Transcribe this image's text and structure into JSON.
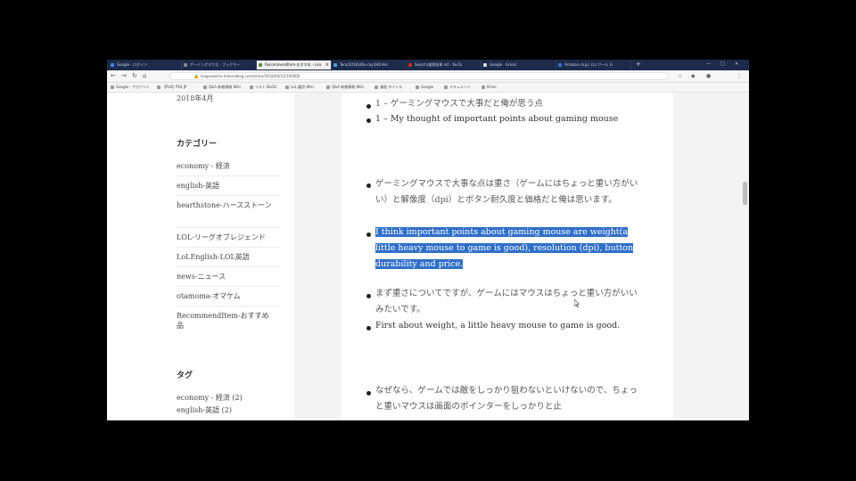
{
  "browser": {
    "tabs": [
      {
        "label": "Google - ログイン",
        "color": "#4285f4",
        "active": false
      },
      {
        "label": "ゲーミングマウス - ブックマー",
        "color": "#888888",
        "active": false
      },
      {
        "label": "RecommendItem-おすすめ – Lea",
        "color": "#5a8f3c",
        "active": true
      },
      {
        "label": "Tera(2018)(Blu-ray)/HD-Ver",
        "color": "#4aa0e0",
        "active": false
      },
      {
        "label": "Search(検索結果 ref - YouTu",
        "color": "#e02020",
        "active": false
      },
      {
        "label": "Google - Gmail",
        "color": "#e0e0e0",
        "active": false
      },
      {
        "label": "Amazon.co.jp: ロジクール G",
        "color": "#3a6fd8",
        "active": false
      }
    ],
    "new_tab_label": "+",
    "window_controls": [
      "—",
      "□",
      "✕"
    ],
    "url": "leaguelolmo.hatenablog.com/entry/2018/04/13/193000",
    "bookmarks": [
      "Google - アカウント",
      "【Ps4】PS4 JP",
      "Q&A 新着情報 Wiki",
      "リスト BLOG",
      "LoL 翻訳 Wiki",
      "Q&A 新着情報 Wiki",
      "漫画 タイトル",
      "Google",
      "ドキュメント",
      "Drive"
    ]
  },
  "sidebar": {
    "archive_date": "2018年4月",
    "categories_heading": "カテゴリー",
    "categories": [
      "economy - 経済",
      "english-英語",
      "hearthstone-ハースストーン",
      "LOL-リーグオブレジェンド",
      "LoLEnglish-LOL英語",
      "news-ニュース",
      "otamoma-オマケム",
      "RecommendItem-おすすめ品"
    ],
    "tags_heading": "タグ",
    "tags": [
      "economy - 経済 (2)",
      "english-英語 (2)"
    ]
  },
  "article": {
    "heading_ja": "1 – ゲーミングマウスで大事だと俺が思う点",
    "heading_en": "1 – My thought of important points about gaming mouse",
    "p1_ja": "ゲーミングマウスで大事な点は重さ（ゲームにはちょっと重い方がいい）と解像度（dpi）とボタン耐久度と価格だと俺は思います。",
    "p1_en": "I think important points about gaming mouse are weight(a little heavy mouse to game is good), resolution (dpi), button durability and price.",
    "p2_ja": "まず重さについてですが、ゲームにはマウスはちょっと重い方がいいみたいです。",
    "p2_en": "First about weight, a little heavy mouse to game is good.",
    "p3_ja": "なぜなら、ゲームでは敵をしっかり狙わないといけないので、ちょっと重いマウスは画面のポインターをしっかりと止"
  },
  "colors": {
    "tabbar": "#1c2b4a",
    "highlight": "#2f6fca",
    "page_bg": "#f3f3f3",
    "content_bg": "#ffffff"
  }
}
